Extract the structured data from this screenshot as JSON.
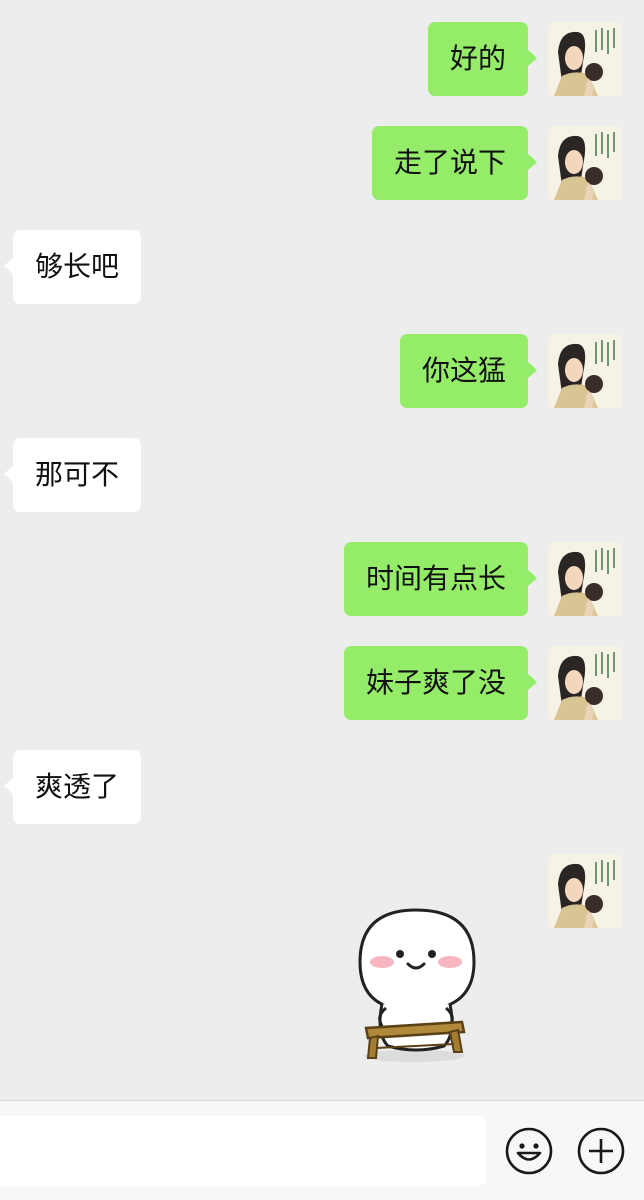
{
  "messages": [
    {
      "side": "out",
      "text": "好的"
    },
    {
      "side": "out",
      "text": "走了说下"
    },
    {
      "side": "in",
      "text": "够长吧"
    },
    {
      "side": "out",
      "text": "你这猛"
    },
    {
      "side": "in",
      "text": "那可不"
    },
    {
      "side": "out",
      "text": "时间有点长"
    },
    {
      "side": "out",
      "text": "妹子爽了没"
    },
    {
      "side": "in",
      "text": "爽透了"
    }
  ],
  "sticker": {
    "icon": "smiling-blob-on-bench-sticker"
  },
  "input": {
    "value": "",
    "placeholder": ""
  },
  "icons": {
    "emoji": "smiley-face-icon",
    "plus": "plus-circle-icon"
  },
  "colors": {
    "background": "#ededed",
    "outgoing_bubble": "#95ec69",
    "incoming_bubble": "#ffffff",
    "input_bar": "#f7f7f7"
  }
}
